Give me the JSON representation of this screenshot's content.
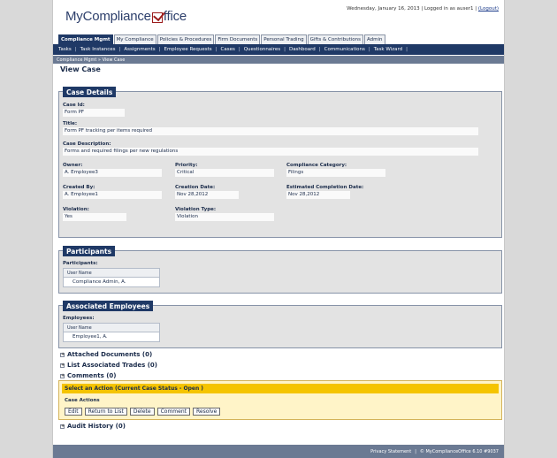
{
  "header": {
    "logo_text_left": "MyCompliance",
    "logo_text_right": "ffice",
    "date": "Wednesday, January 16, 2013",
    "login_text": "| Logged in as auser1 |",
    "logout": "(Logout)"
  },
  "tabs": [
    {
      "label": "Compliance Mgmt"
    },
    {
      "label": "My Compliance"
    },
    {
      "label": "Policies & Procedures"
    },
    {
      "label": "Firm Documents"
    },
    {
      "label": "Personal Trading"
    },
    {
      "label": "Gifts & Contributions"
    },
    {
      "label": "Admin"
    }
  ],
  "subnav": [
    "Tasks",
    "Task Instances",
    "Assignments",
    "Employee Requests",
    "Cases",
    "Questionnaires",
    "Dashboard",
    "Communications",
    "Task Wizard"
  ],
  "breadcrumb": "Compliance Mgmt »   View Case",
  "page_title": "View Case",
  "case_details": {
    "title": "Case Details",
    "case_id_label": "Case Id:",
    "case_id": "Form PF",
    "title_label": "Title:",
    "title_value": "Form PF tracking per items required",
    "description_label": "Case Description:",
    "description": "Forms and required filings per new regulations",
    "owner_label": "Owner:",
    "owner": "A. Employee3",
    "priority_label": "Priority:",
    "priority": "Critical",
    "category_label": "Compliance Category:",
    "category": "Filings",
    "created_by_label": "Created By:",
    "created_by": "A. Employee1",
    "creation_date_label": "Creation Date:",
    "creation_date": "Nov 28,2012",
    "est_completion_label": "Estimated Completion Date:",
    "est_completion": "Nov 28,2012",
    "violation_label": "Violation:",
    "violation": "Yes",
    "violation_type_label": "Violation Type:",
    "violation_type": "Violation"
  },
  "participants": {
    "title": "Participants",
    "label": "Participants:",
    "column": "User Name",
    "rows": [
      "Compliance Admin, A."
    ]
  },
  "associated_employees": {
    "title": "Associated Employees",
    "label": "Employees:",
    "column": "User Name",
    "rows": [
      "Employee1, A."
    ]
  },
  "expanders": {
    "attached_documents": "Attached Documents (0)",
    "list_trades": "List Associated Trades (0)",
    "comments": "Comments (0)",
    "audit_history": "Audit History (0)",
    "plus": "+"
  },
  "actions": {
    "header": "Select an Action (Current Case Status - Open )",
    "sub_label": "Case Actions",
    "buttons": [
      "Edit",
      "Return to List",
      "Delete",
      "Comment",
      "Resolve"
    ]
  },
  "footer": {
    "privacy": "Privacy Statement",
    "copyright": "© MyComplianceOffice 6.10 #9037"
  },
  "colors": {
    "navy": "#1f3966",
    "action_yellow": "#f5c400",
    "logo_red": "#9b1c1c"
  }
}
